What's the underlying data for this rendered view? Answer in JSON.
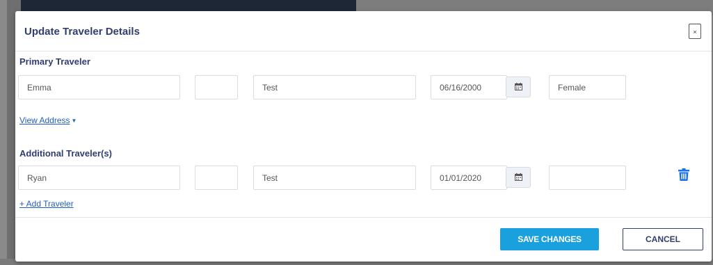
{
  "modal": {
    "title": "Update Traveler Details",
    "close_label": "×"
  },
  "primary": {
    "section_title": "Primary Traveler",
    "first_name": "Emma",
    "middle_name": "",
    "last_name": "Test",
    "dob": "06/16/2000",
    "gender": "Female",
    "view_address_label": "View Address"
  },
  "additional": {
    "section_title": "Additional Traveler(s)",
    "travelers": [
      {
        "first_name": "Ryan",
        "middle_name": "",
        "last_name": "Test",
        "dob": "01/01/2020",
        "gender": ""
      }
    ],
    "add_label": "+ Add Traveler"
  },
  "footer": {
    "save_label": "SAVE CHANGES",
    "cancel_label": "CANCEL"
  },
  "icons": {
    "calendar": "calendar-icon",
    "trash": "trash-icon",
    "caret": "caret-down-icon"
  },
  "colors": {
    "title": "#2f3d70",
    "link": "#1f5fbf",
    "primary_button": "#1aa0dc",
    "trash": "#1a73e8"
  }
}
